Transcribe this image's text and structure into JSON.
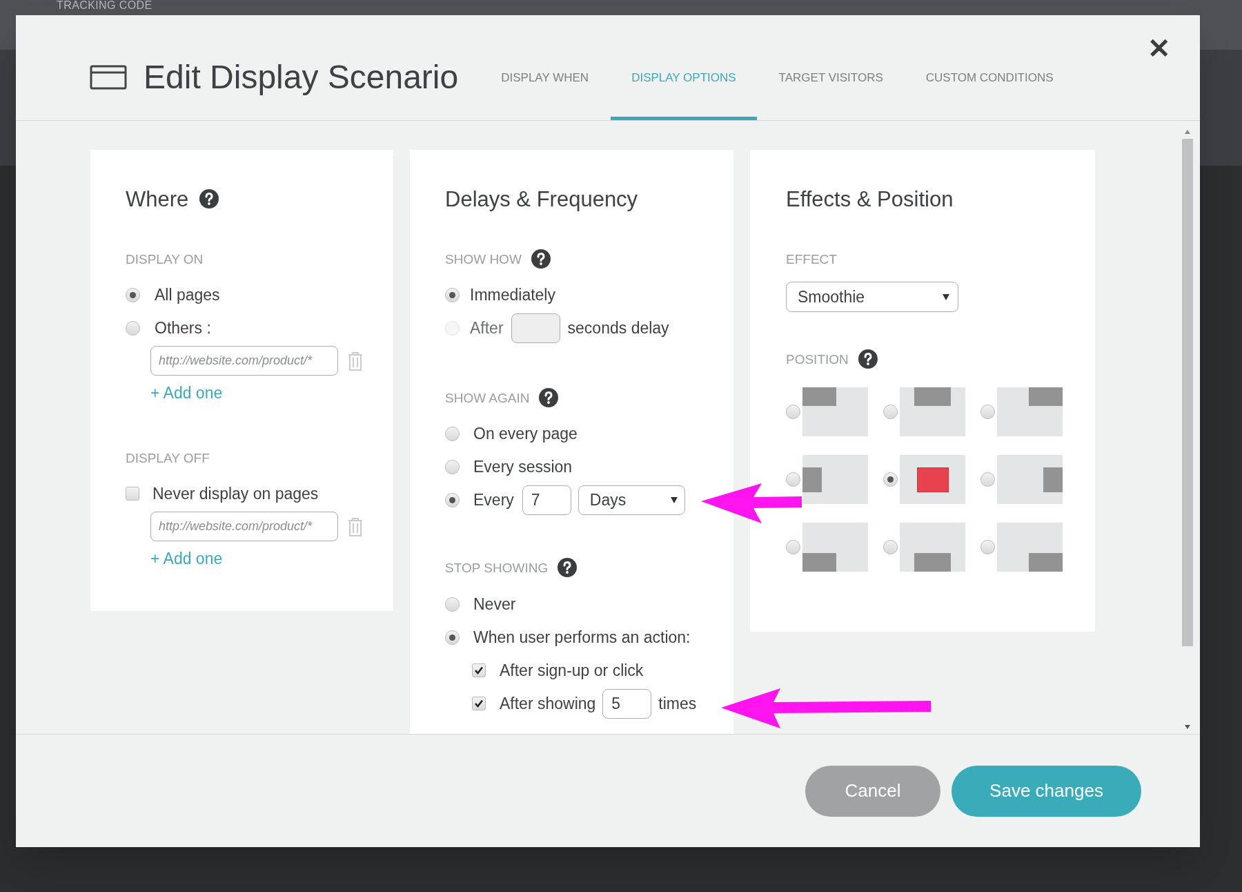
{
  "background": {
    "text": "TRACKING CODE"
  },
  "window": {
    "title": "Edit Display Scenario",
    "close": "✕"
  },
  "tabs": [
    {
      "label": "DISPLAY WHEN",
      "selected": false
    },
    {
      "label": "DISPLAY OPTIONS",
      "selected": true
    },
    {
      "label": "TARGET VISITORS",
      "selected": false
    },
    {
      "label": "CUSTOM CONDITIONS",
      "selected": false
    }
  ],
  "where": {
    "title": "Where",
    "display_on": {
      "label": "DISPLAY ON",
      "options": [
        {
          "label": "All pages",
          "selected": true
        },
        {
          "label": "Others :",
          "selected": false
        }
      ],
      "url_placeholder": "http://website.com/product/*",
      "add_link": "+ Add one"
    },
    "display_off": {
      "label": "DISPLAY OFF",
      "checkbox": {
        "label": "Never display on pages",
        "checked": false
      },
      "url_placeholder": "http://website.com/product/*",
      "add_link": "+ Add one"
    }
  },
  "delays": {
    "title": "Delays & Frequency",
    "show_how": {
      "label": "SHOW HOW",
      "options": [
        {
          "kind": "plain",
          "label": "Immediately",
          "selected": true,
          "disabled": false
        },
        {
          "kind": "delay",
          "label": "After",
          "suffix": "seconds delay",
          "selected": false,
          "disabled": true
        }
      ]
    },
    "show_again": {
      "label": "SHOW AGAIN",
      "options": [
        {
          "kind": "plain",
          "label": "On every page",
          "selected": false
        },
        {
          "kind": "plain",
          "label": "Every session",
          "selected": false
        },
        {
          "kind": "every",
          "label": "Every",
          "value": "7",
          "unit": "Days",
          "selected": true
        }
      ]
    },
    "stop_showing": {
      "label": "STOP SHOWING",
      "options": [
        {
          "label": "Never",
          "selected": false
        },
        {
          "label": "When user performs an action:",
          "selected": true
        }
      ],
      "actions": [
        {
          "kind": "plain",
          "label": "After sign-up or click",
          "checked": true
        },
        {
          "kind": "count",
          "label": "After showing",
          "value": "5",
          "suffix": "times",
          "checked": true
        }
      ]
    }
  },
  "effects": {
    "title": "Effects & Position",
    "effect": {
      "label": "EFFECT",
      "value": "Smoothie"
    },
    "position": {
      "label": "POSITION",
      "options": [
        {
          "selected": false
        },
        {
          "selected": false
        },
        {
          "selected": false
        },
        {
          "selected": false
        },
        {
          "selected": true
        },
        {
          "selected": false
        },
        {
          "selected": false
        },
        {
          "selected": false
        },
        {
          "selected": false
        }
      ]
    }
  },
  "buttons": [
    {
      "kind": "secondary",
      "label": "Cancel"
    },
    {
      "kind": "primary",
      "label": "Save changes"
    }
  ]
}
